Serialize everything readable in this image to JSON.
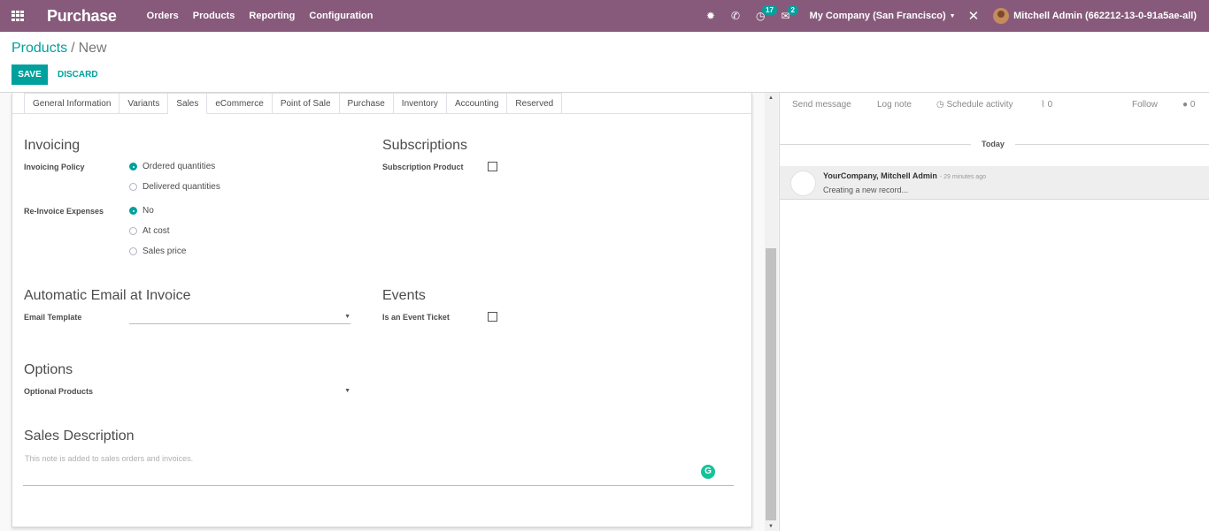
{
  "navbar": {
    "app_name": "Purchase",
    "menu": [
      "Orders",
      "Products",
      "Reporting",
      "Configuration"
    ],
    "activity_count": "17",
    "message_count": "2",
    "company": "My Company (San Francisco)",
    "user": "Mitchell Admin (662212-13-0-91a5ae-all)",
    "bg_color": "#875a7b"
  },
  "breadcrumb": {
    "parent": "Products",
    "separator": "/",
    "current": "New"
  },
  "buttons": {
    "save": "SAVE",
    "discard": "DISCARD"
  },
  "tabs": [
    "General Information",
    "Variants",
    "Sales",
    "eCommerce",
    "Point of Sale",
    "Purchase",
    "Inventory",
    "Accounting",
    "Reserved"
  ],
  "active_tab": "Sales",
  "invoicing": {
    "title": "Invoicing",
    "policy_label": "Invoicing Policy",
    "policy_options": [
      "Ordered quantities",
      "Delivered quantities"
    ],
    "policy_selected": "Ordered quantities",
    "reinvoice_label": "Re-Invoice Expenses",
    "reinvoice_options": [
      "No",
      "At cost",
      "Sales price"
    ],
    "reinvoice_selected": "No"
  },
  "subscriptions": {
    "title": "Subscriptions",
    "product_label": "Subscription Product",
    "checked": false
  },
  "auto_email": {
    "title": "Automatic Email at Invoice",
    "template_label": "Email Template",
    "template_value": ""
  },
  "events": {
    "title": "Events",
    "ticket_label": "Is an Event Ticket",
    "checked": false
  },
  "options": {
    "title": "Options",
    "optional_label": "Optional Products",
    "value": ""
  },
  "sales_description": {
    "title": "Sales Description",
    "placeholder": "This note is added to sales orders and invoices.",
    "grammarly_glyph": "G"
  },
  "chatter": {
    "send_message": "Send message",
    "log_note": "Log note",
    "schedule_activity": "Schedule activity",
    "attachments": "0",
    "follow": "Follow",
    "followers": "0",
    "date_separator": "Today",
    "message": {
      "author": "YourCompany, Mitchell Admin",
      "date": "- 29 minutes ago",
      "body": "Creating a new record..."
    }
  },
  "accent_color": "#00a09d"
}
